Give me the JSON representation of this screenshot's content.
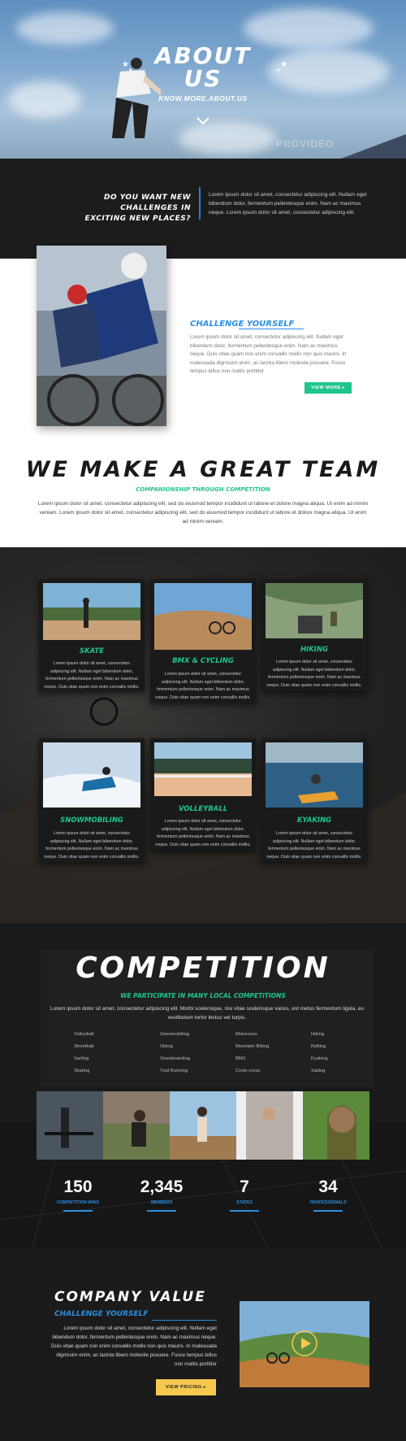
{
  "hero": {
    "title_line1": "ABOUT",
    "title_line2": "US",
    "subtitle": "KNOW.MORE.ABOUT.US",
    "watermark": "PROVIDEO"
  },
  "challenge_strip": {
    "question_line1": "DO YOU WANT NEW CHALLENGES IN",
    "question_line2": "EXCITING NEW PLACES?",
    "text": "Lorem ipsum dolor sit amet, consectetur adipiscing elit. Nullam eget bibendum dolor, fermentum pellentesque enim. Nam ac maximus neque. Lorem ipsum dolor sit amet, consectetur adipiscing elit."
  },
  "challenge_yourself": {
    "title": "CHALLENGE YOURSELF",
    "text": "Lorem ipsum dolor sit amet, consectetur adipiscing elit. Nullam eget bibendum dolor, fermentum pellentesque enim. Nam ac maximus neque. Duis vitae quam non enim convallis mollis non quis mauris. In malesuada dignissim enim, ac lacinia libero molestie posuere. Fusce tempus tellus non mattis porttitor",
    "button": "VIEW MORE ▸"
  },
  "team": {
    "title": "WE MAKE A GREAT TEAM",
    "subtitle": "COMPANIONSHIP THROUGH COMPETITION",
    "text": "Lorem ipsum dolor sit amet, consectetur adipiscing elit, sed do eiusmod tempor incididunt ut labore et dolore magna aliqua. Ut enim ad minim veniam. Lorem ipsum dolor sit amet, consectetur adipiscing elit, sed do eiusmod tempor incididunt ut labore et dolore magna aliqua. Ut enim ad minim veniam."
  },
  "activities": [
    {
      "title": "SKATE",
      "text": "Lorem ipsum dolor sit amet, consectetur adipiscing elit. Nullam eget bibendum dolor, fermentum pellentesque enim. Nam ac maximus neque. Duis vitae quam non enim convallis mollis."
    },
    {
      "title": "BMX & CYCLING",
      "text": "Lorem ipsum dolor sit amet, consectetur adipiscing elit. Nullam eget bibendum dolor, fermentum pellentesque enim. Nam ac maximus neque. Duis vitae quam non enim convallis mollis."
    },
    {
      "title": "HIKING",
      "text": "Lorem ipsum dolor sit amet, consectetur adipiscing elit. Nullam eget bibendum dolor, fermentum pellentesque enim. Nam ac maximus neque. Duis vitae quam non enim convallis mollis."
    },
    {
      "title": "SNOWMOBILING",
      "text": "Lorem ipsum dolor sit amet, consectetur adipiscing elit. Nullam eget bibendum dolor, fermentum pellentesque enim. Nam ac maximus neque. Duis vitae quam non enim convallis mollis."
    },
    {
      "title": "VOLLEYBALL",
      "text": "Lorem ipsum dolor sit amet, consectetur adipiscing elit. Nullam eget bibendum dolor, fermentum pellentesque enim. Nam ac maximus neque. Duis vitae quam non enim convallis mollis."
    },
    {
      "title": "KYAKING",
      "text": "Lorem ipsum dolor sit amet, consectetur adipiscing elit. Nullam eget bibendum dolor, fermentum pellentesque enim. Nam ac maximus neque. Duis vitae quam non enim convallis mollis."
    }
  ],
  "competition": {
    "title": "COMPETITION",
    "subtitle": "WE PARTICIPATE IN MANY LOCAL COMPETITIONS",
    "text": "Lorem ipsum dolor sit amet, consectetur adipiscing elit. Morbi scelerisque, nisi vitae scelerisque varius, est metus fermentum ligula, eu vestibulum tortor lectus vel turpis.",
    "sports_col1": [
      "Volleyball",
      "Streetball",
      "Surfing",
      "Skating"
    ],
    "sports_col2": [
      "Snowmobiling",
      "Skiing",
      "Snowboarding",
      "Trail Running"
    ],
    "sports_col3": [
      "Motocross",
      "Mountain Biking",
      "BMX",
      "Cycle-cross"
    ],
    "sports_col4": [
      "Hiking",
      "Rafting",
      "Kyaking",
      "Sailing"
    ]
  },
  "stats": [
    {
      "value": "150",
      "label": "COMPETITION WINS"
    },
    {
      "value": "2,345",
      "label": "MEMBERS"
    },
    {
      "value": "7",
      "label": "STATES"
    },
    {
      "value": "34",
      "label": "PROFESSIONALS"
    }
  ],
  "company_value": {
    "title": "COMPANY VALUE",
    "subtitle": "CHALLENGE YOURSELF",
    "text": "Lorem ipsum dolor sit amet, consectetur adipiscing elit. Nullam eget bibendum dolor, fermentum pellentesque enim. Nam ac maximus neque. Duis vitae quam non enim convallis mollis non quis mauris. In malesuada dignissim enim, ac lacinia libero molestie posuere. Fusce tempus tellus non mattis porttitor",
    "button": "VIEW PRICING ▸"
  },
  "colors": {
    "accent_green": "#1ec58c",
    "accent_blue": "#2b8fe0",
    "button_yellow": "#f7c84f",
    "dark_bg": "#1a1a1a"
  },
  "icons": [
    "chevron-down-icon",
    "star-icon",
    "play-icon"
  ]
}
